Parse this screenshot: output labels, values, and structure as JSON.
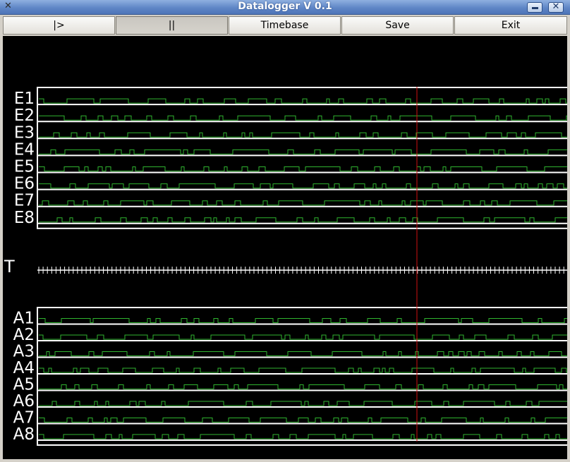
{
  "window": {
    "title": "Datalogger  V 0.1"
  },
  "toolbar": {
    "buttons": [
      {
        "label": "|>"
      },
      {
        "label": "||"
      },
      {
        "label": "Timebase"
      },
      {
        "label": "Save"
      },
      {
        "label": "Exit"
      }
    ]
  },
  "scope": {
    "digital_channels": [
      "E1",
      "E2",
      "E3",
      "E4",
      "E5",
      "E6",
      "E7",
      "E8"
    ],
    "analog_channels": [
      "A1",
      "A2",
      "A3",
      "A4",
      "A5",
      "A6",
      "A7",
      "A8"
    ],
    "timebase_label": "T",
    "colors": {
      "trace": "#2fb52f",
      "frame": "#ffffff",
      "cursor": "#d01010",
      "background": "#000000"
    }
  }
}
